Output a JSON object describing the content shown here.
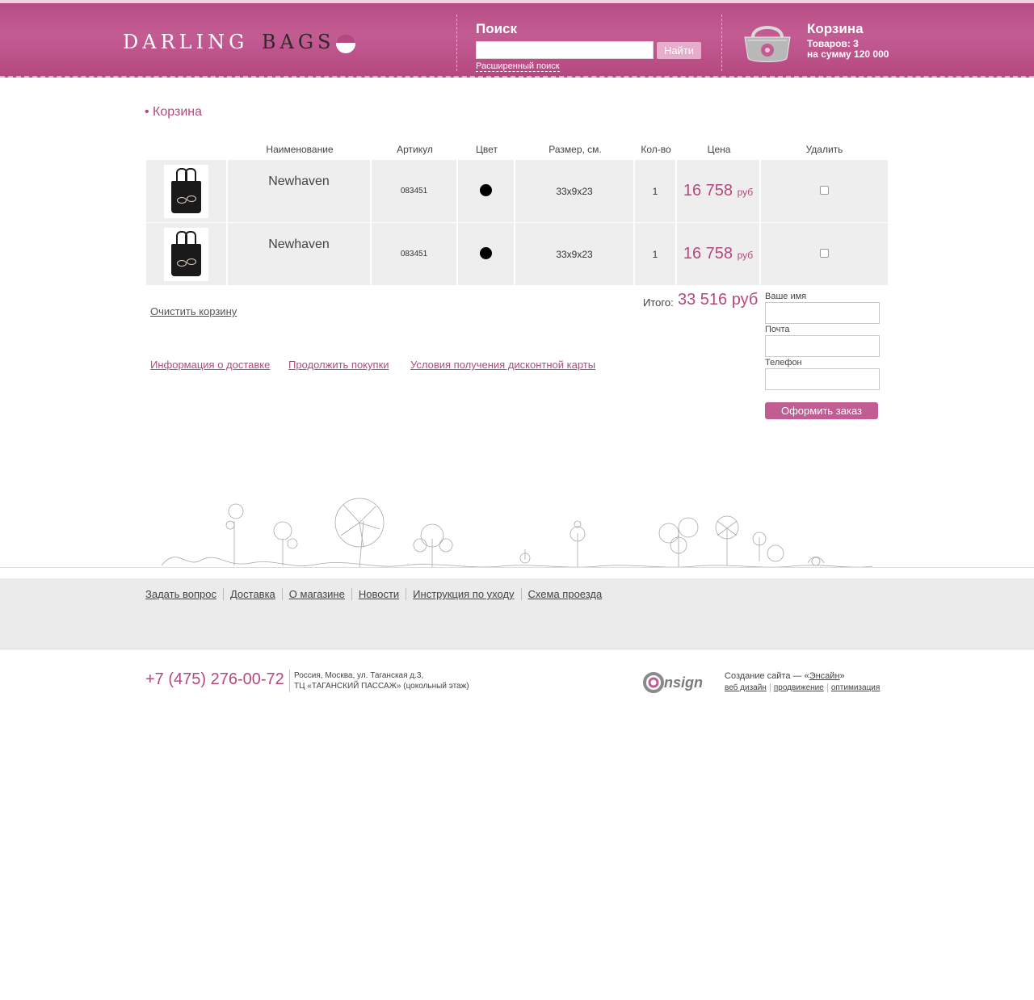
{
  "header": {
    "logo_left": "DARLING",
    "logo_right": "BAGS",
    "search_title": "Поиск",
    "search_placeholder": "",
    "search_button": "Найти",
    "advanced_search": "Расширенный поиск",
    "cart_title": "Корзина",
    "cart_count": "Товаров: 3",
    "cart_sum": "на сумму 120 000"
  },
  "breadcrumb": "Корзина",
  "table": {
    "headers": [
      "",
      "Наименование",
      "Артикул",
      "Цвет",
      "Размер, см.",
      "Кол-во",
      "Цена",
      "Удалить"
    ],
    "rows": [
      {
        "name": "Newhaven",
        "article": "083451",
        "color": "#000000",
        "size": "33x9x23",
        "qty": "1",
        "price": "16 758",
        "currency": "руб"
      },
      {
        "name": "Newhaven",
        "article": "083451",
        "color": "#000000",
        "size": "33x9x23",
        "qty": "1",
        "price": "16 758",
        "currency": "руб"
      }
    ]
  },
  "clear_cart": "Очистить корзину",
  "total": {
    "label": "Итого:",
    "value": "33 516 руб"
  },
  "links": {
    "delivery_info": "Информация о доставке",
    "continue_shopping": "Продолжить покупки",
    "discount_terms": "Условия получения дисконтной карты"
  },
  "form": {
    "name_label": "Ваше имя",
    "email_label": "Почта",
    "phone_label": "Телефон",
    "submit": "Оформить заказ"
  },
  "footer_nav": [
    "Задать вопрос",
    "Доставка",
    "О магазине",
    "Новости",
    "Инструкция по уходу",
    "Схема проезда"
  ],
  "contacts": {
    "phone": "+7 (475) 276-00-72",
    "address_line1": "Россия, Москва, ул. Таганская д.3,",
    "address_line2": "ТЦ «ТАГАНСКИЙ ПАССАЖ» (цокольный этаж)"
  },
  "credits": {
    "logo_text": "nsign",
    "created_prefix": "Создание сайта — «",
    "created_link": "Энсайн",
    "created_suffix": "»",
    "services": [
      "веб дизайн",
      "продвижение",
      "оптимизация"
    ]
  },
  "colors": {
    "brand": "#b5497f",
    "header": "#c35c93",
    "footer": "#ebebeb"
  }
}
